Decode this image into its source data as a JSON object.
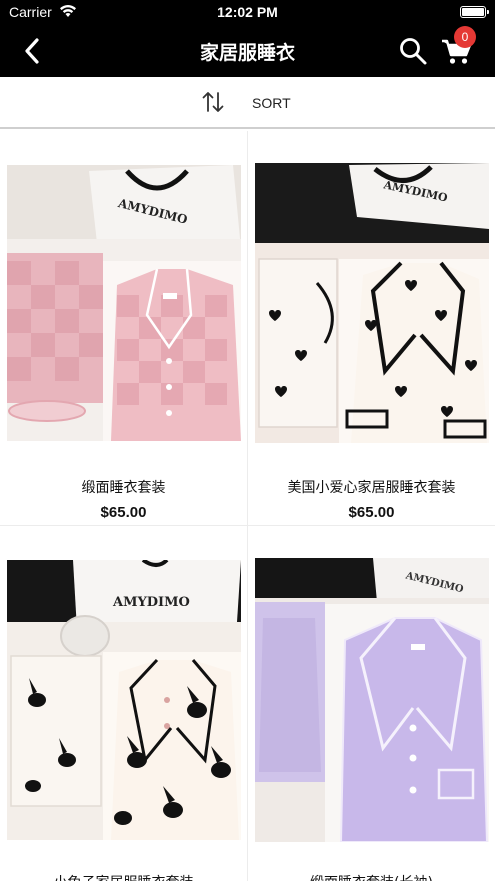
{
  "status_bar": {
    "carrier": "Carrier",
    "time": "12:02 PM"
  },
  "nav": {
    "title": "家居服睡衣",
    "back_icon": "chevron-left-icon",
    "search_icon": "search-icon",
    "cart_icon": "cart-icon",
    "cart_count": "0"
  },
  "sort": {
    "icon": "sort-arrows-icon",
    "label": "SORT"
  },
  "products": [
    {
      "name": "缎面睡衣套装",
      "price": "$65.00",
      "image_alt": "pink checkered satin pajama set in gift box"
    },
    {
      "name": "美国小爱心家居服睡衣套装",
      "price": "$65.00",
      "image_alt": "white heart print pajama set with black piping"
    },
    {
      "name": "小兔子家居服睡衣套装",
      "price": "",
      "image_alt": "cream bunny print pajama set with scrunchie"
    },
    {
      "name": "缎面睡衣套装(长袖)",
      "price": "",
      "image_alt": "lavender satin pajama set in gift box"
    }
  ],
  "brand_text": "AMYDIMO",
  "colors": {
    "header_bg": "#000000",
    "badge": "#e53935",
    "divider": "#ececec"
  }
}
